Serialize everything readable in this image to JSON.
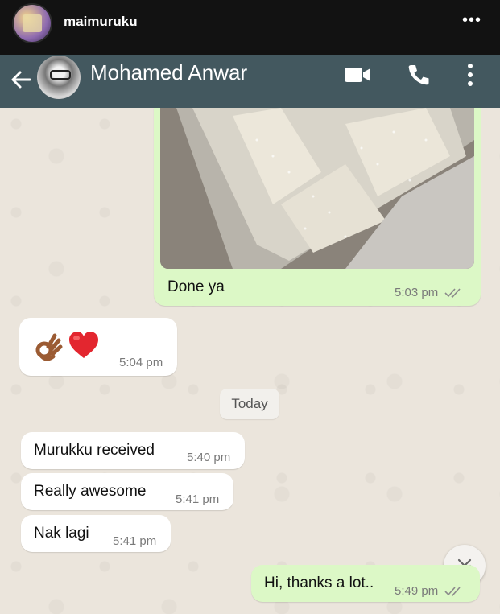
{
  "instagram": {
    "username": "maimuruku",
    "more_icon": "more-horizontal-icon",
    "more_glyph": "•••"
  },
  "header": {
    "contact_name": "Mohamed Anwar",
    "icons": [
      "back-arrow-icon",
      "video-call-icon",
      "voice-call-icon",
      "more-vertical-icon"
    ],
    "color": "#43585f"
  },
  "messages": [
    {
      "type": "image",
      "direction": "outgoing",
      "caption": "Done ya",
      "time": "5:03 pm",
      "status": "read"
    },
    {
      "type": "emoji",
      "direction": "incoming",
      "emojis": [
        "ok-hand-icon",
        "red-heart-icon"
      ],
      "time": "5:04 pm"
    },
    {
      "type": "date_divider",
      "label": "Today"
    },
    {
      "type": "text",
      "direction": "incoming",
      "text": "Murukku received",
      "time": "5:40 pm"
    },
    {
      "type": "text",
      "direction": "incoming",
      "text": "Really awesome",
      "time": "5:41 pm"
    },
    {
      "type": "text",
      "direction": "incoming",
      "text": "Nak lagi",
      "time": "5:41 pm"
    },
    {
      "type": "text",
      "direction": "outgoing",
      "text": "Hi, thanks a lot..",
      "time": "5:49 pm",
      "status": "read"
    }
  ],
  "colors": {
    "outgoing_bubble": "#dcf8c6",
    "incoming_bubble": "#ffffff",
    "chat_background": "#ebe5dc"
  }
}
